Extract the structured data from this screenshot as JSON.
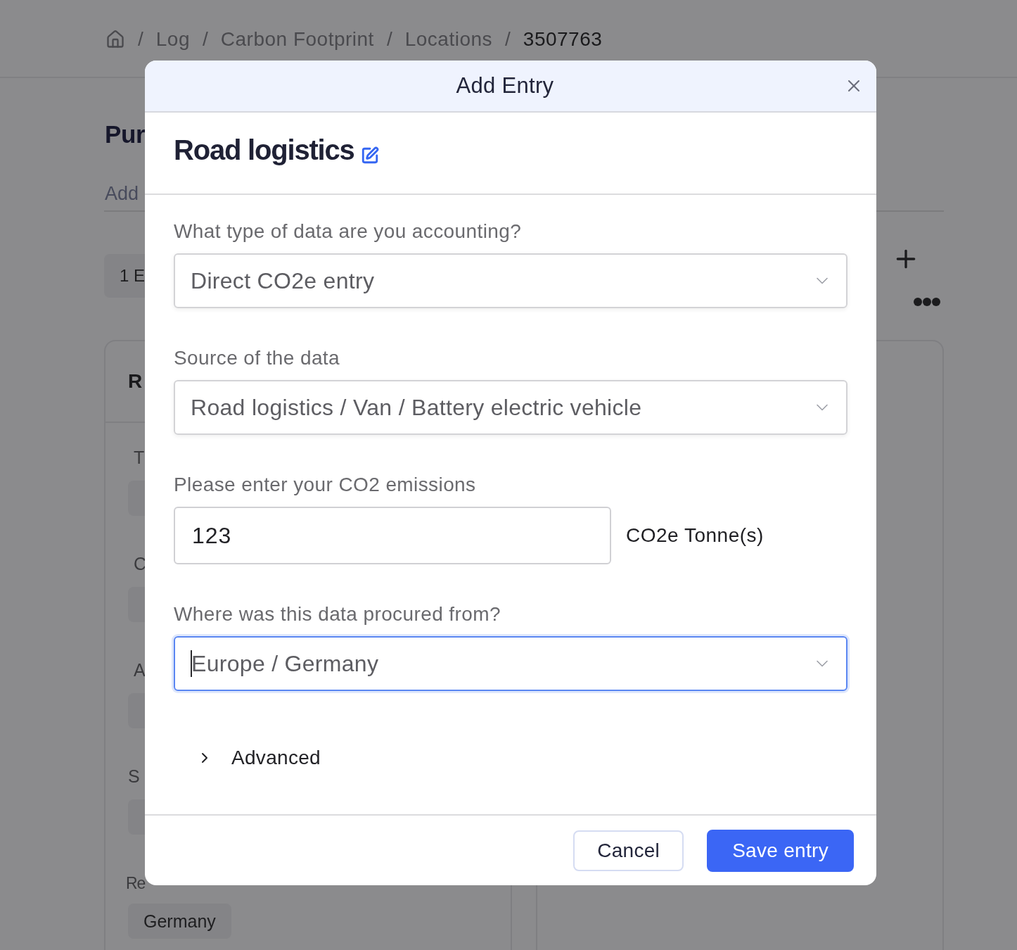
{
  "breadcrumb": {
    "items": [
      {
        "separator": "/",
        "label": "Log",
        "current": false
      },
      {
        "separator": "/",
        "label": "Carbon Footprint",
        "current": false
      },
      {
        "separator": "/",
        "label": "Locations",
        "current": false
      },
      {
        "separator": "/",
        "label": "3507763",
        "current": true
      }
    ]
  },
  "page": {
    "title": "Pur",
    "tab": "Add",
    "count": "1 E",
    "card": {
      "title": "R",
      "fields": [
        {
          "label": "T"
        },
        {
          "label": "C"
        },
        {
          "label": "A"
        },
        {
          "label": "S"
        },
        {
          "label": "Re",
          "value": "Germany"
        }
      ]
    }
  },
  "dialog": {
    "title": "Add Entry",
    "entry_name": "Road logistics",
    "fields": [
      {
        "kind": "select",
        "label": "What type of data are you accounting?",
        "value": "Direct CO2e entry",
        "focused": false
      },
      {
        "kind": "select",
        "label": "Source of the data",
        "value": "Road logistics / Van / Battery electric vehicle",
        "focused": false
      },
      {
        "kind": "number",
        "label": "Please enter your CO2 emissions",
        "value": "123",
        "unit": "CO2e Tonne(s)",
        "focused": false
      },
      {
        "kind": "select",
        "label": "Where was this data procured from?",
        "value": "Europe / Germany",
        "focused": true
      }
    ],
    "advanced": {
      "label": "Advanced",
      "expanded": false
    },
    "buttons": [
      {
        "kind": "secondary",
        "label": "Cancel"
      },
      {
        "kind": "primary",
        "label": "Save entry"
      }
    ]
  }
}
